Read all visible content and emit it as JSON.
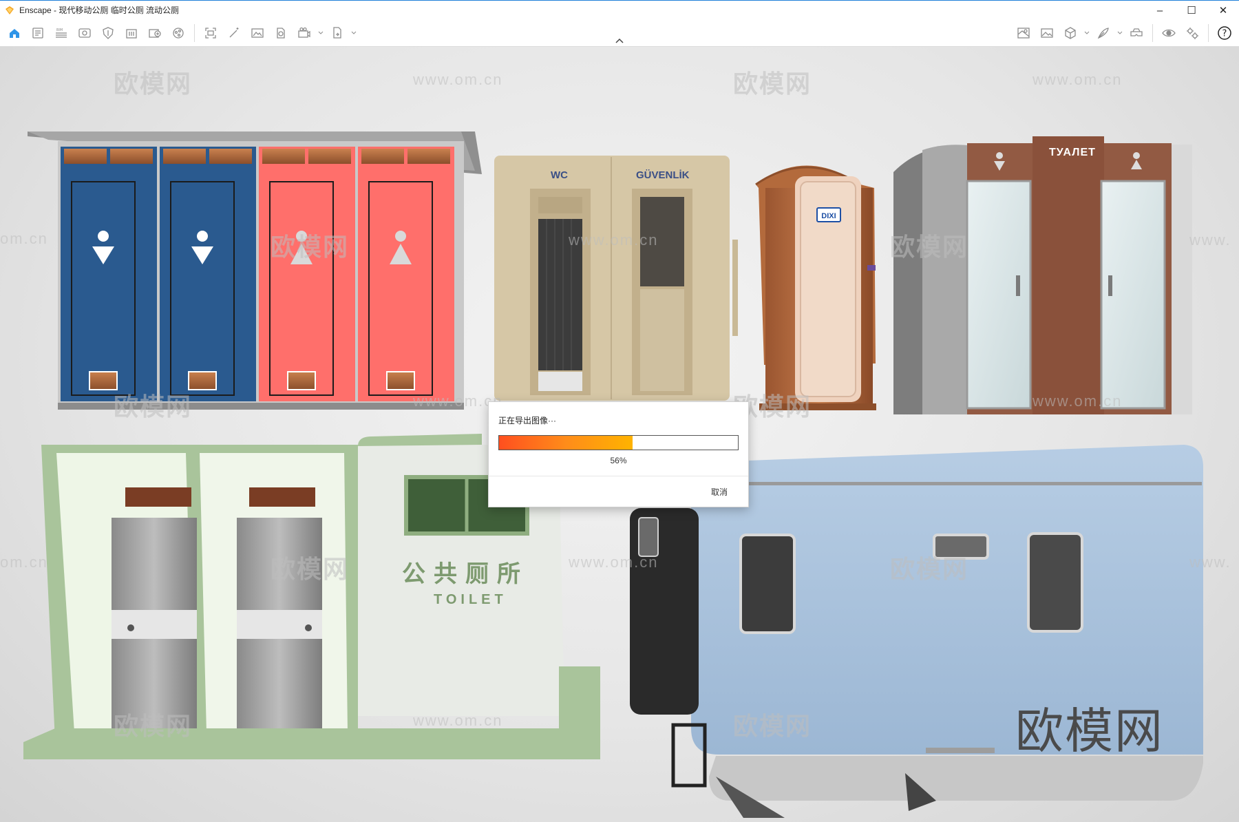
{
  "app": {
    "title": "Enscape - 现代移动公厕 临时公厕 流动公厕",
    "logo_icon": "enscape-logo-icon",
    "accent": "#1e7fd8"
  },
  "window_controls": {
    "minimize": "–",
    "maximize": "☐",
    "close": "✕"
  },
  "toolbar": {
    "left_icons": [
      "home-icon",
      "document-icon",
      "bim-icon",
      "view-icon",
      "shield-icon",
      "building-icon",
      "asset-icon",
      "sphere-icon",
      "capture-icon",
      "wand-icon",
      "image-icon",
      "panorama-icon",
      "video-icon",
      "export-icon"
    ],
    "right_icons": [
      "map-icon",
      "gallery-icon",
      "cube-icon",
      "feather-icon",
      "vr-icon",
      "eye-icon",
      "settings-icon",
      "help-icon"
    ],
    "help_label": "?"
  },
  "scene": {
    "signs": {
      "wc": "WC",
      "guvenlik": "GÜVENLİK",
      "dixi": "DIXI",
      "tualet": "ТУАЛЕТ",
      "public_toilet_cn": "公共厕所",
      "toilet": "TOILET"
    },
    "watermarks": {
      "brand": "欧模网",
      "url": "www.om.cn",
      "url_edge": "om.cn",
      "url_edge_right": "www."
    },
    "colors": {
      "blue_door": "#2a5a8f",
      "red_door": "#ff6f6b",
      "beige_cabin": "#d6c7a6",
      "copper_booth": "#b36a3c",
      "brown_panel": "#925a43",
      "green_frame": "#a9c49b",
      "light_blue_trailer": "#a9c3de"
    }
  },
  "export_dialog": {
    "message": "正在导出图像···",
    "progress_percent": 56,
    "progress_label": "56%",
    "cancel_label": "取消"
  }
}
